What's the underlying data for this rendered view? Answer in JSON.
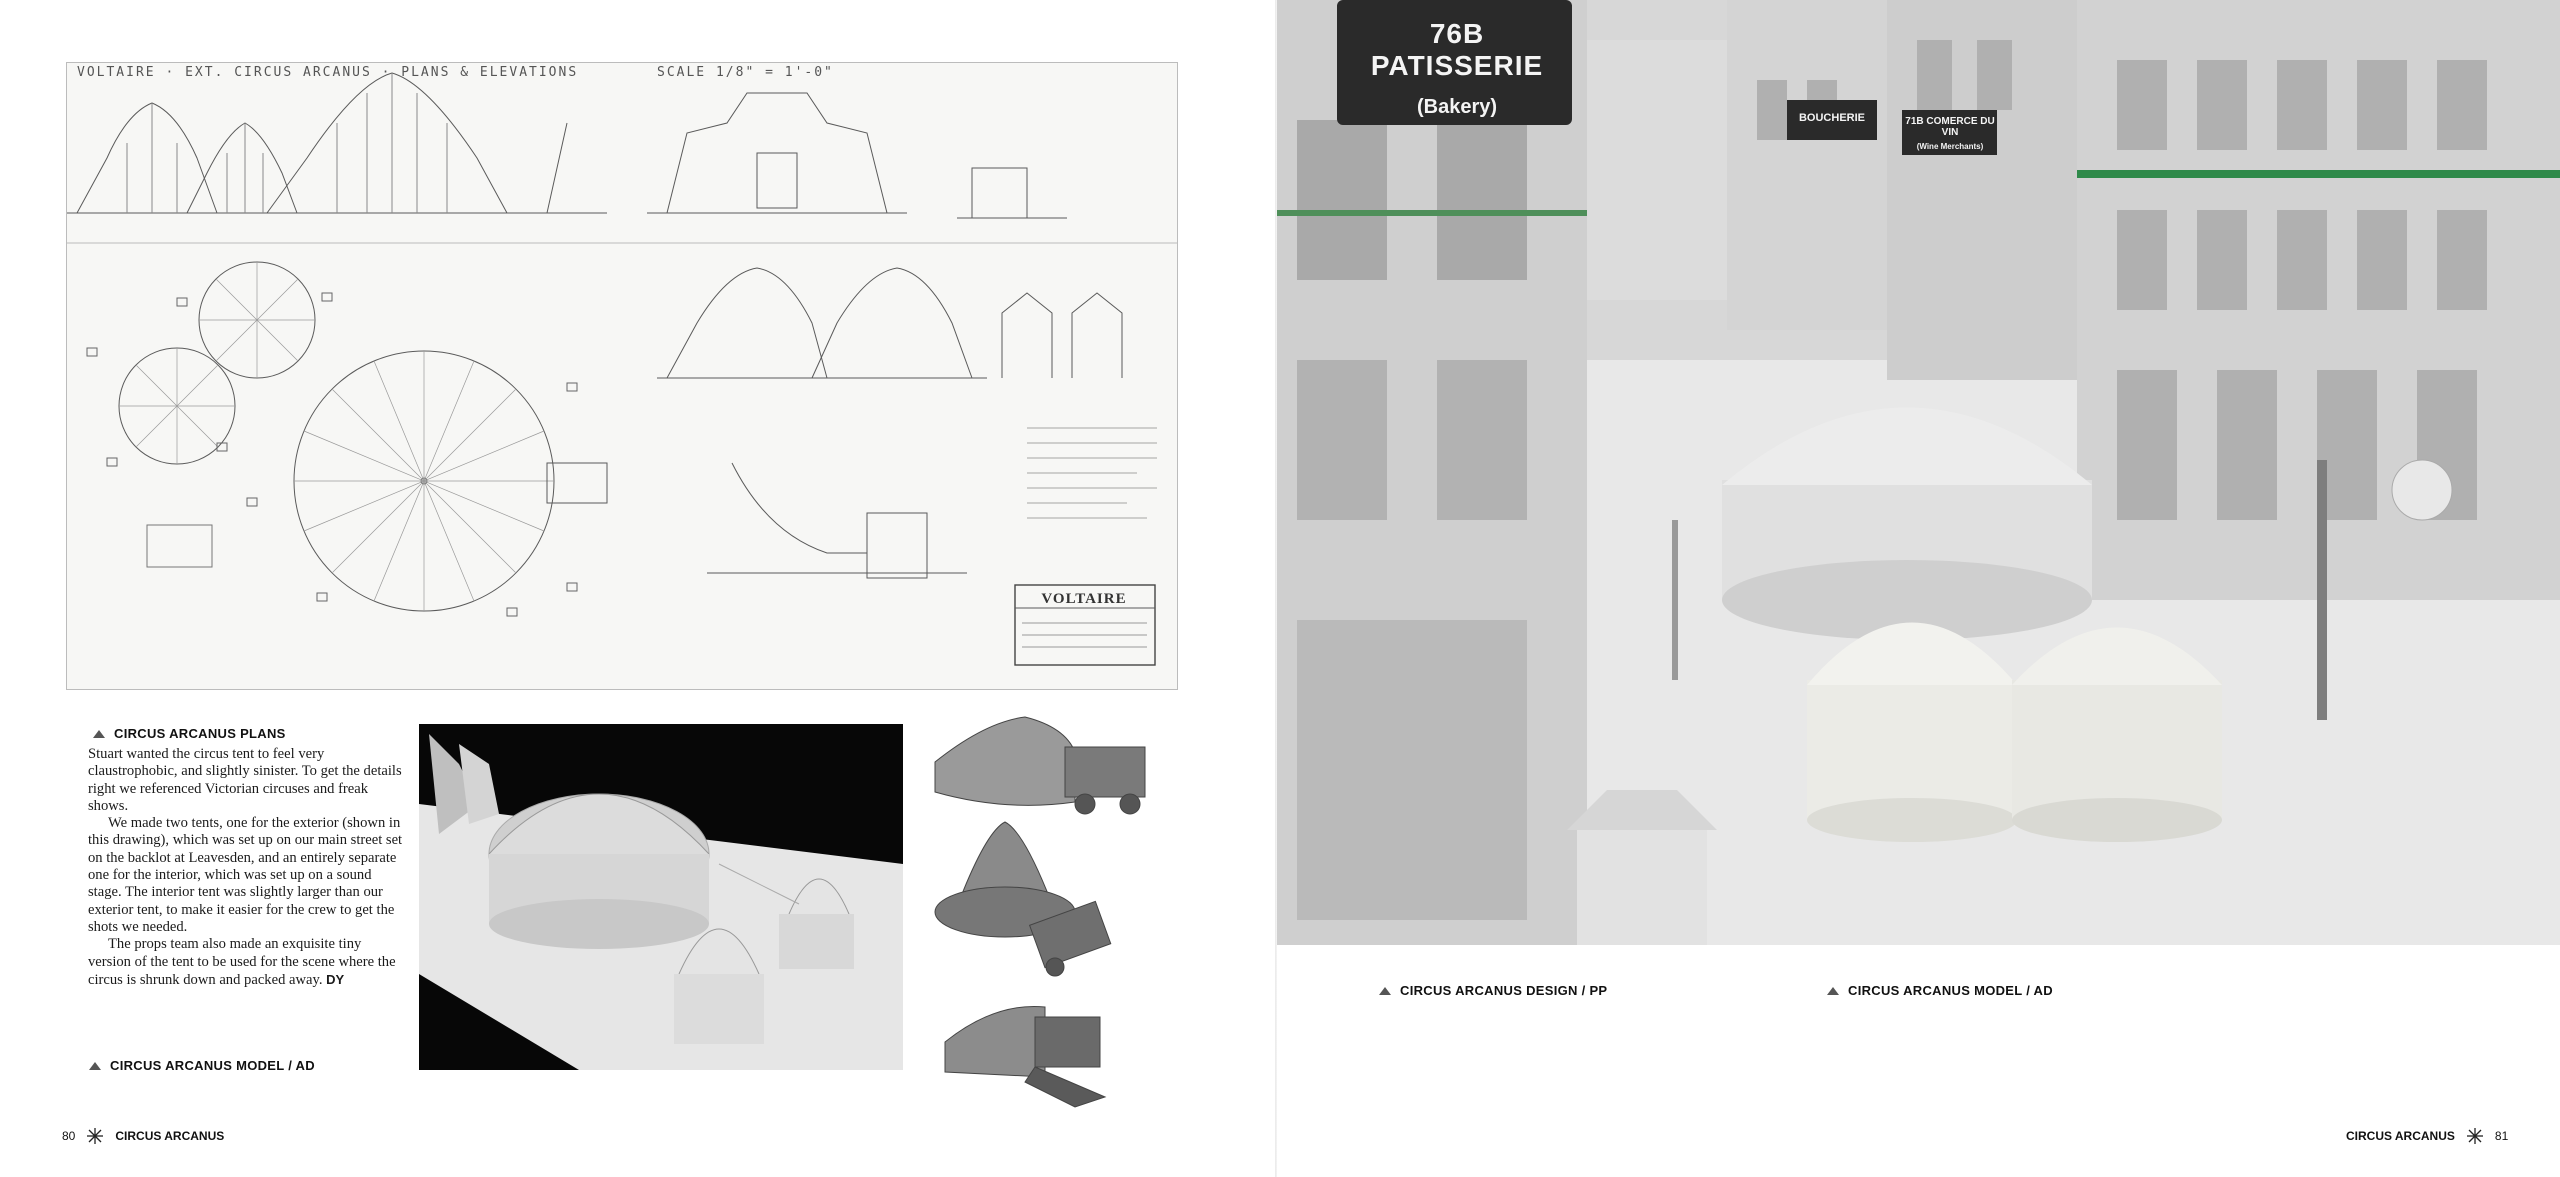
{
  "blueprint": {
    "title": "VOLTAIRE · EXT. CIRCUS ARCANUS · PLANS & ELEVATIONS",
    "scale": "SCALE 1/8\" = 1'-0\"",
    "stamp": "VOLTAIRE"
  },
  "captions": {
    "plans": "CIRCUS ARCANUS PLANS",
    "model_left": "CIRCUS ARCANUS MODEL / AD",
    "design_right": "CIRCUS ARCANUS DESIGN / PP",
    "model_right": "CIRCUS ARCANUS MODEL / AD"
  },
  "body": {
    "p1": "Stuart wanted the circus tent to feel very claustrophobic, and slightly sinister. To get the details right we referenced Victorian circuses and freak shows.",
    "p2": "We made two tents, one for the exterior (shown in this drawing), which was set up on our main street set on the backlot at Leavesden, and an entirely separate one for the interior, which was set up on a sound stage. The interior tent was slightly larger than our exterior tent, to make it easier for the crew to get the shots we needed.",
    "p3": "The props team also made an exquisite tiny version of the tent to be used for the scene where the circus is shrunk down and packed away.",
    "signature": "DY"
  },
  "street_signs": {
    "bakery": "76B PATISSERIE",
    "bakery_sub": "(Bakery)",
    "boucherie": "BOUCHERIE",
    "commerce": "71B COMERCE DU VIN",
    "commerce_sub": "(Wine Merchants)"
  },
  "footer": {
    "left_page_number": "80",
    "left_title": "CIRCUS ARCANUS",
    "right_title": "CIRCUS ARCANUS",
    "right_page_number": "81"
  },
  "colors": {
    "text": "#111111",
    "background": "#ffffff",
    "model_bg": "#070707",
    "accent_green": "#2f8a4a"
  },
  "icons": {
    "caption_icon": "tent-icon",
    "folio_icon": "star-icon"
  }
}
